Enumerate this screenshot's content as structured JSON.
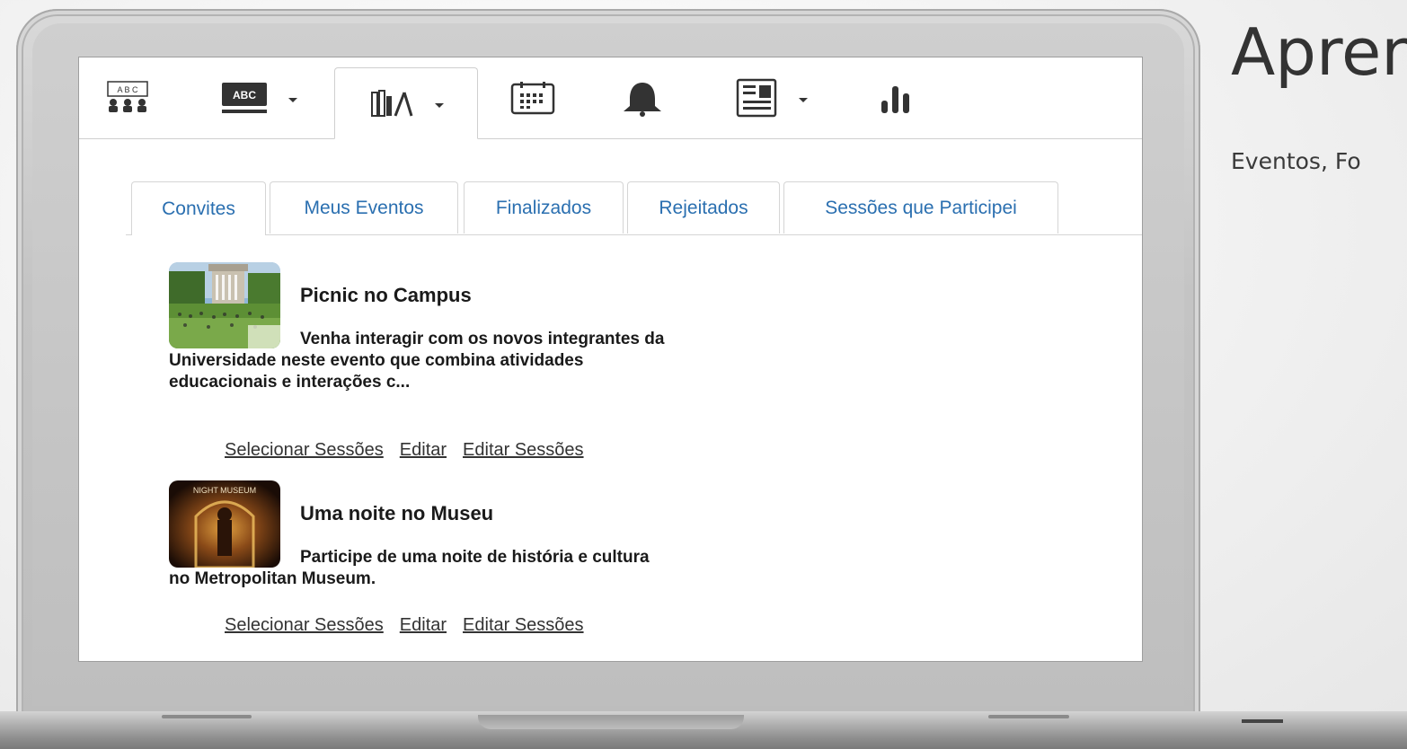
{
  "side": {
    "title": "Apren",
    "subtitle": "Eventos, Fo"
  },
  "toolbar": {
    "icons": [
      "abc-board-icon",
      "abc-dropdown-icon",
      "library-icon",
      "calendar-icon",
      "bell-icon",
      "newspaper-icon",
      "chart-icon"
    ],
    "active_index": 2
  },
  "tabs": [
    {
      "label": "Convites"
    },
    {
      "label": "Meus Eventos"
    },
    {
      "label": "Finalizados"
    },
    {
      "label": "Rejeitados"
    },
    {
      "label": "Sessões que Participei"
    }
  ],
  "active_tab": 0,
  "events": [
    {
      "title": "Picnic no Campus",
      "description": "Venha interagir com os novos integrantes da Universidade neste evento que combina atividades educacionais e interações c...",
      "links": [
        "Selecionar Sessões",
        "Editar",
        "Editar Sessões"
      ]
    },
    {
      "title": "Uma noite no Museu",
      "description": "Participe de uma noite de história e cultura no Metropolitan Museum.",
      "thumb_text": "NIGHT MUSEUM",
      "links": [
        "Selecionar Sessões",
        "Editar",
        "Editar Sessões"
      ]
    }
  ],
  "colors": {
    "tab_text": "#2a6fb0",
    "event_text": "#1a1a1a"
  }
}
